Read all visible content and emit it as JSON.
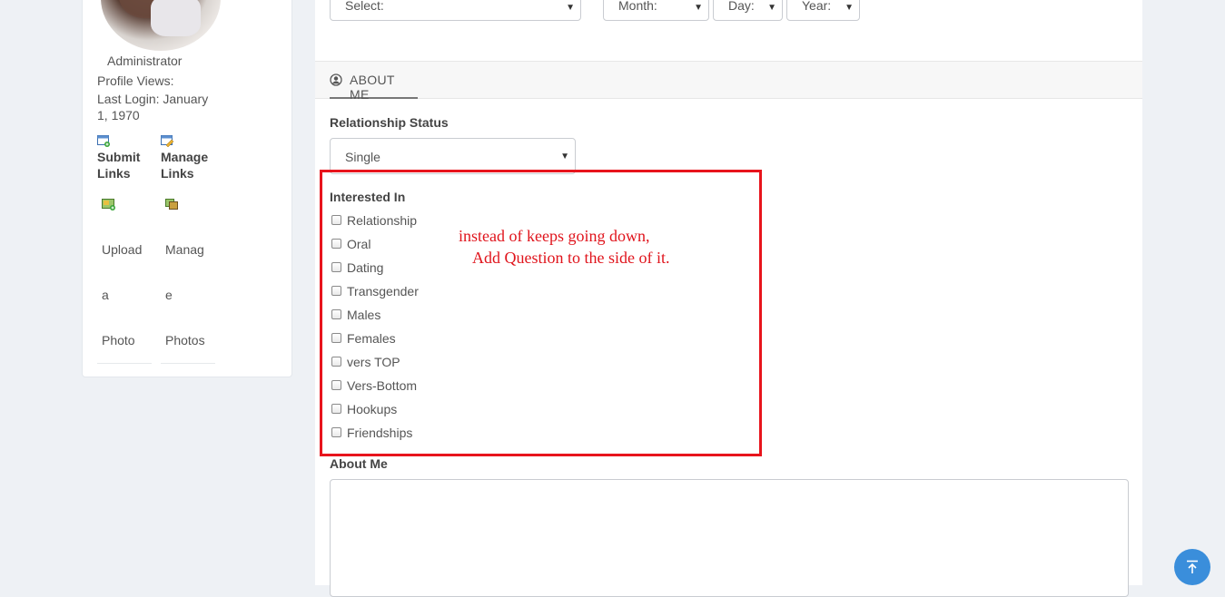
{
  "sidebar": {
    "role": "Administrator",
    "profile_views": "Profile Views:",
    "last_login_line1": "Last Login: January",
    "last_login_line2": "1, 1970",
    "submit_links": [
      "Submit",
      "Links"
    ],
    "manage_links": [
      "Manage",
      "Links"
    ],
    "upload_photo": [
      "Upload",
      "a",
      "Photo"
    ],
    "manage_photos": [
      "Manag",
      "e",
      "Photos"
    ]
  },
  "top_selects": {
    "select": "Select:",
    "month": "Month:",
    "day": "Day:",
    "year": "Year:"
  },
  "section": {
    "tab_label": "ABOUT ME",
    "tab_icon": "user-circle-icon"
  },
  "relationship": {
    "label": "Relationship Status",
    "value": "Single"
  },
  "interested": {
    "label": "Interested In",
    "options": [
      "Relationship",
      "Oral",
      "Dating",
      "Transgender",
      "Males",
      "Females",
      "vers TOP",
      "Vers-Bottom",
      "Hookups",
      "Friendships"
    ]
  },
  "annotation": {
    "line1": "instead of keeps going down,",
    "line2": "Add Question to the side of it.",
    "color": "#e8141c"
  },
  "about_me": {
    "label": "About Me"
  },
  "fab": {
    "icon": "scroll-to-top-icon"
  }
}
